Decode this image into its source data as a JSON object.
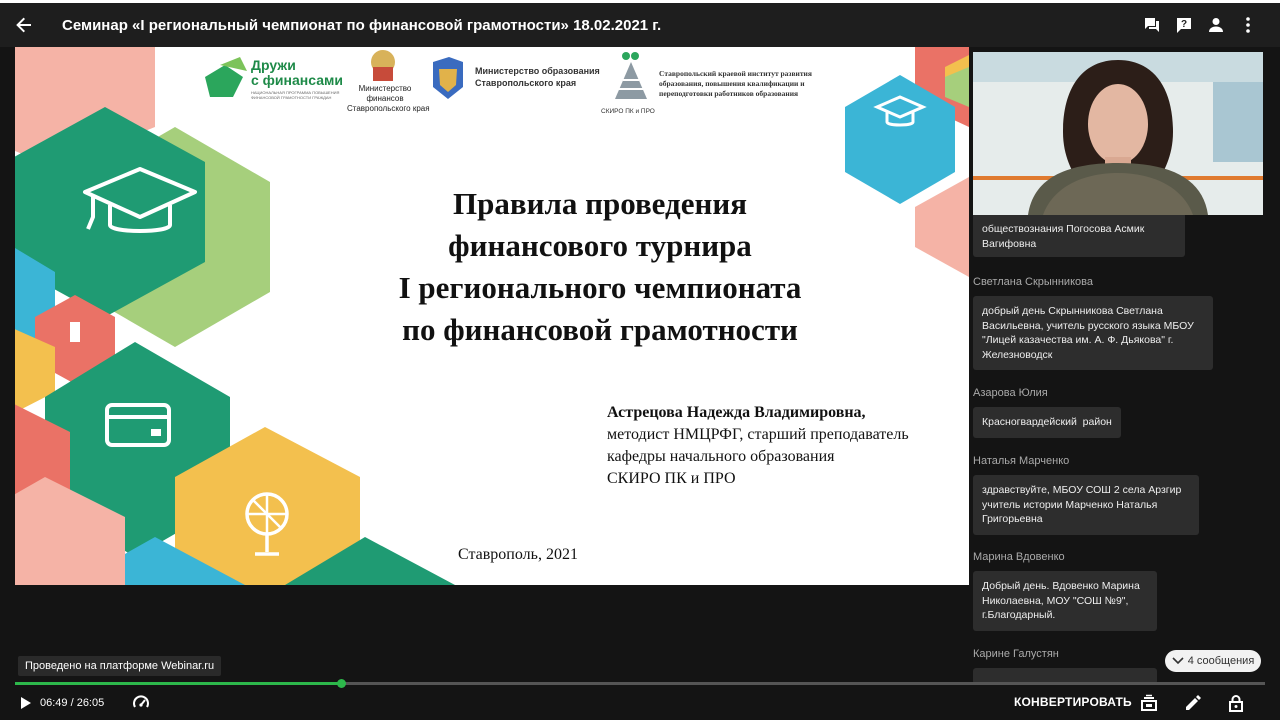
{
  "header": {
    "title": "Семинар «I региональный чемпионат по финансовой грамотности» 18.02.2021 г.",
    "icons": [
      "back-arrow-icon",
      "chat-icon",
      "help-icon",
      "person-icon",
      "more-vert-icon"
    ]
  },
  "slide": {
    "logos": {
      "druzhi": "Дружи\nс финансами",
      "druzhi_sub": "НАЦИОНАЛЬНАЯ ПРОГРАММА ПОВЫШЕНИЯ\nФИНАНСОВОЙ ГРАМОТНОСТИ ГРАЖДАН",
      "minfin": "Министерство\nфинансов\nСтавропольского края",
      "minobr": "Министерство образования\nСтавропольского края",
      "skiro": "Ставропольский краевой институт развития\nобразования, повышения квалификации и\nпереподготовки работников образования",
      "skiro_abbr": "СКИРО ПК и ПРО"
    },
    "title_lines": [
      "Правила проведения",
      "финансового турнира",
      "I регионального чемпионата",
      "по финансовой грамотности"
    ],
    "author_name": "Астрецова Надежда Владимировна,",
    "author_lines": [
      "методист НМЦРФГ, старший преподаватель",
      "кафедры начального образования",
      "СКИРО ПК и ПРО"
    ],
    "city": "Ставрополь, 2021"
  },
  "platform_label": "Проведено на платформе Webinar.ru",
  "chat": {
    "partial_message": "обществознания Погосова Асмик\nВагифовна",
    "messages": [
      {
        "author": "Светлана Скрынникова",
        "text": "добрый день Скрынникова Светлана\nВасильевна, учитель русского языка МБОУ\n\"Лицей казачества им. А. Ф. Дьякова\" г.\nЖелезноводск"
      },
      {
        "author": "Азарова Юлия",
        "text": "Красногвардейский  район"
      },
      {
        "author": "Наталья Марченко",
        "text": "здравствуйте, МБОУ СОШ 2 села Арзгир\nучитель истории Марченко Наталья\nГригорьевна"
      },
      {
        "author": "Марина Вдовенко",
        "text": "Добрый день. Вдовенко Марина\nНиколаевна, МОУ \"СОШ №9\",\nг.Благодарный."
      },
      {
        "author": "Карине Галустян",
        "text": ""
      }
    ],
    "new_messages": "4 сообщения"
  },
  "player": {
    "time": "06:49 / 26:05",
    "progress": 0.2611,
    "convert_label": "КОНВЕРТИРОВАТЬ",
    "icons": [
      "play-icon",
      "speed-icon",
      "layout-icon",
      "edit-icon",
      "lock-icon"
    ]
  },
  "colors": {
    "accent": "#2db84b",
    "background": "#141414",
    "bubble": "#2d2d2d"
  }
}
